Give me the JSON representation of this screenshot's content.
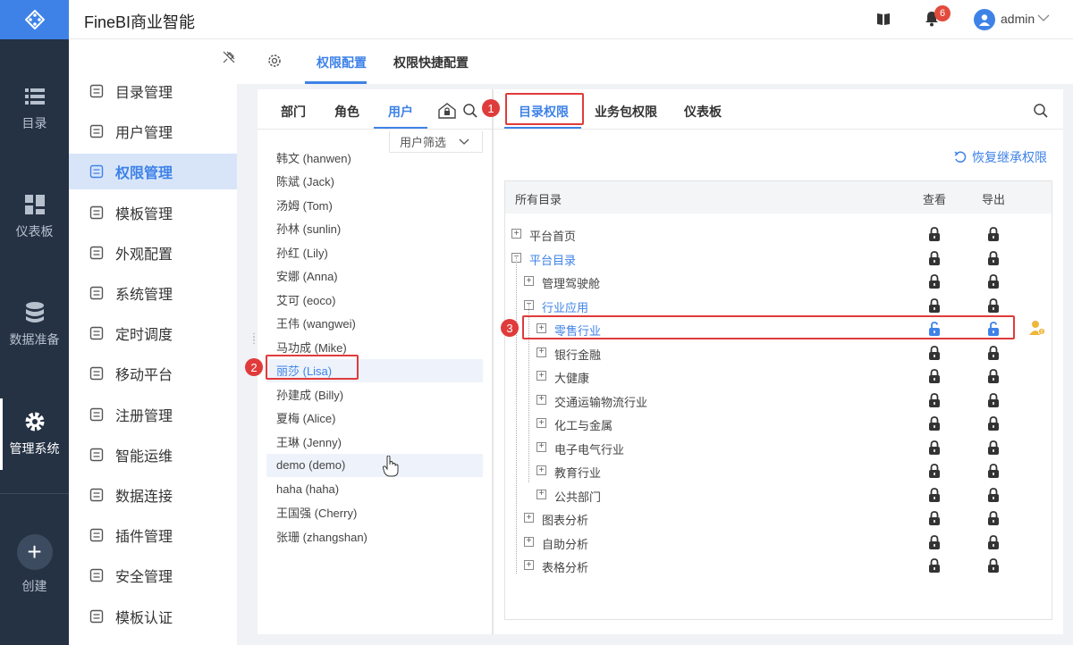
{
  "app": {
    "title": "FineBI商业智能",
    "user": "admin",
    "notifications": "6"
  },
  "rail": [
    {
      "label": "目录",
      "icon": "list-icon"
    },
    {
      "label": "仪表板",
      "icon": "dashboard-icon"
    },
    {
      "label": "数据准备",
      "icon": "database-icon"
    },
    {
      "label": "管理系统",
      "icon": "gear-icon",
      "active": true
    },
    {
      "label": "创建",
      "icon": "plus-icon"
    }
  ],
  "menu": [
    {
      "label": "目录管理"
    },
    {
      "label": "用户管理"
    },
    {
      "label": "权限管理",
      "active": true
    },
    {
      "label": "模板管理"
    },
    {
      "label": "外观配置"
    },
    {
      "label": "系统管理"
    },
    {
      "label": "定时调度"
    },
    {
      "label": "移动平台"
    },
    {
      "label": "注册管理"
    },
    {
      "label": "智能运维"
    },
    {
      "label": "数据连接"
    },
    {
      "label": "插件管理"
    },
    {
      "label": "安全管理"
    },
    {
      "label": "模板认证"
    }
  ],
  "content_tabs": {
    "perm_config": "权限配置",
    "quick_config": "权限快捷配置"
  },
  "users_panel": {
    "tabs": {
      "dept": "部门",
      "role": "角色",
      "user": "用户"
    },
    "filter": "用户筛选",
    "users": [
      "韩文 (hanwen)",
      "陈斌 (Jack)",
      "汤姆 (Tom)",
      "孙林 (sunlin)",
      "孙红 (Lily)",
      "安娜 (Anna)",
      "艾可 (eoco)",
      "王伟 (wangwei)",
      "马功成 (Mike)",
      "丽莎 (Lisa)",
      "孙建成 (Billy)",
      "夏梅 (Alice)",
      "王琳 (Jenny)",
      "demo (demo)",
      "haha (haha)",
      "王国强 (Cherry)",
      "张珊 (zhangshan)"
    ]
  },
  "perm_panel": {
    "tabs": {
      "catalog": "目录权限",
      "package": "业务包权限",
      "dashboard": "仪表板"
    },
    "restore": "恢复继承权限",
    "columns": {
      "all": "所有目录",
      "view": "查看",
      "export": "导出"
    },
    "tree": [
      {
        "label": "平台首页",
        "toggle": "+"
      },
      {
        "label": "平台目录",
        "toggle": "−"
      },
      {
        "label": "管理驾驶舱",
        "toggle": "+"
      },
      {
        "label": "行业应用",
        "toggle": "−"
      },
      {
        "label": "零售行业",
        "toggle": "+"
      },
      {
        "label": "银行金融",
        "toggle": "+"
      },
      {
        "label": "大健康",
        "toggle": "+"
      },
      {
        "label": "交通运输物流行业",
        "toggle": "+"
      },
      {
        "label": "化工与金属",
        "toggle": "+"
      },
      {
        "label": "电子电气行业",
        "toggle": "+"
      },
      {
        "label": "教育行业",
        "toggle": "+"
      },
      {
        "label": "公共部门",
        "toggle": "+"
      },
      {
        "label": "图表分析",
        "toggle": "+"
      },
      {
        "label": "自助分析",
        "toggle": "+"
      },
      {
        "label": "表格分析",
        "toggle": "+"
      }
    ]
  },
  "annotations": [
    "1",
    "2",
    "3"
  ],
  "colors": {
    "accent": "#3e82e8",
    "rail": "#253244",
    "annotation": "#e03b3b"
  }
}
